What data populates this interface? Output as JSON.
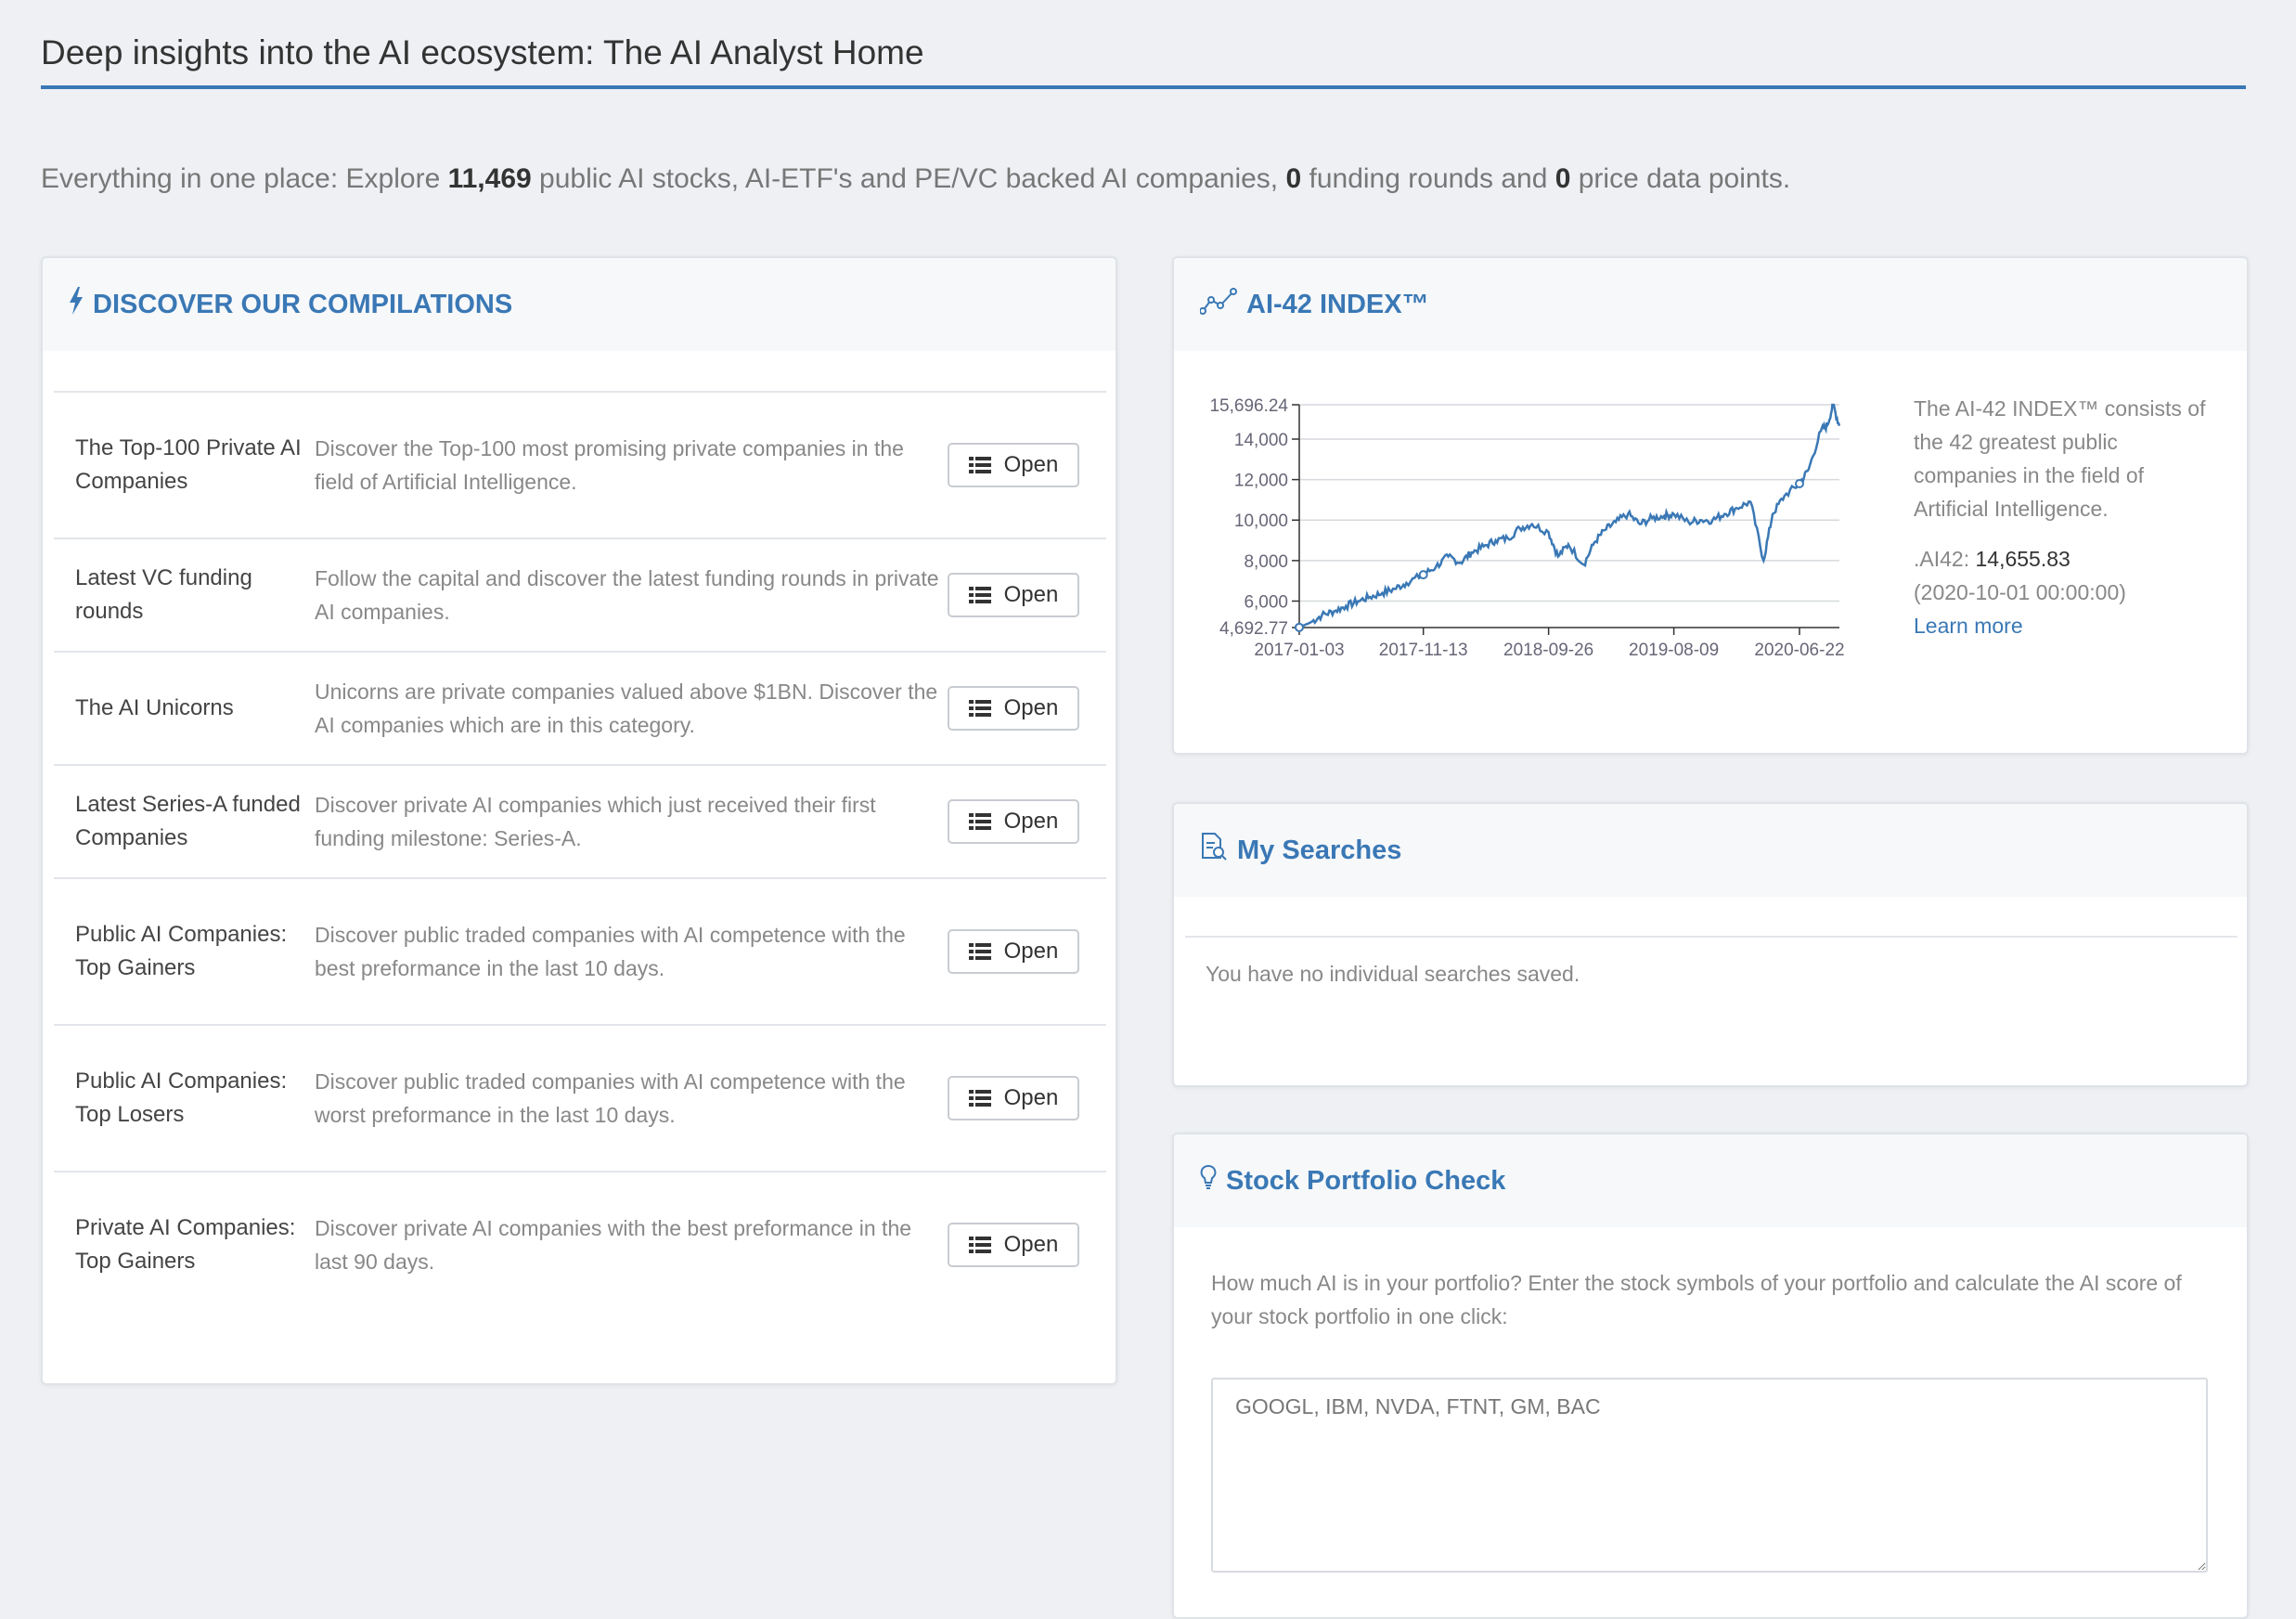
{
  "page": {
    "title": "Deep insights into the AI ecosystem: The AI Analyst Home",
    "intro": {
      "prefix": "Everything in one place: Explore ",
      "stocks_count": "11,469",
      "middle": " public AI stocks, AI-ETF's and PE/VC backed AI companies, ",
      "funding_count": "0",
      "middle2": " funding rounds and ",
      "price_count": "0",
      "suffix": " price data points."
    }
  },
  "compilations": {
    "title": "DISCOVER OUR COMPILATIONS",
    "open_label": "Open",
    "rows": [
      {
        "name": "The Top-100 Private AI Companies",
        "desc": "Discover the Top-100 most promising private companies in the field of Artificial Intelligence."
      },
      {
        "name": "Latest VC funding rounds",
        "desc": "Follow the capital and discover the latest funding rounds in private AI companies."
      },
      {
        "name": "The AI Unicorns",
        "desc": "Unicorns are private companies valued above $1BN. Discover the AI companies which are in this category."
      },
      {
        "name": "Latest Series-A funded Companies",
        "desc": "Discover private AI companies which just received their first funding milestone: Series-A."
      },
      {
        "name": "Public AI Companies: Top Gainers",
        "desc": "Discover public traded companies with AI competence with the best preformance in the last 10 days."
      },
      {
        "name": "Public AI Companies: Top Losers",
        "desc": "Discover public traded companies with AI competence with the worst preformance in the last 10 days."
      },
      {
        "name": "Private AI Companies: Top Gainers",
        "desc": "Discover private AI companies with the best preformance in the last 90 days."
      }
    ]
  },
  "index": {
    "title": "AI-42 INDEX™",
    "description": "The AI-42 INDEX™ consists of the 42 greatest public companies in the field of Artificial Intelligence.",
    "symbol_label": ".AI42: ",
    "value": "14,655.83",
    "timestamp": "(2020-10-01 00:00:00)",
    "learn_more": "Learn more"
  },
  "chart_data": {
    "type": "line",
    "title": "",
    "xlabel": "",
    "ylabel": "",
    "ylim": [
      4692.77,
      15696.24
    ],
    "y_ticks": [
      "15,696.24",
      "14,000",
      "12,000",
      "10,000",
      "8,000",
      "6,000",
      "4,692.77"
    ],
    "y_tick_values": [
      15696.24,
      14000,
      12000,
      10000,
      8000,
      6000,
      4692.77
    ],
    "x_ticks": [
      "2017-01-03",
      "2017-11-13",
      "2018-09-26",
      "2019-08-09",
      "2020-06-22"
    ],
    "grid": true,
    "color": "#3a78b5",
    "series": [
      {
        "x": [
          "2017-01-03",
          "2017-02-01",
          "2017-03-01",
          "2017-04-01",
          "2017-05-01",
          "2017-06-01",
          "2017-07-01",
          "2017-08-01",
          "2017-09-01",
          "2017-10-01",
          "2017-11-13",
          "2017-12-15",
          "2018-01-15",
          "2018-02-15",
          "2018-03-15",
          "2018-04-15",
          "2018-05-15",
          "2018-06-15",
          "2018-07-15",
          "2018-08-15",
          "2018-09-26",
          "2018-10-20",
          "2018-11-15",
          "2018-12-24",
          "2019-01-20",
          "2019-02-15",
          "2019-03-15",
          "2019-04-15",
          "2019-05-15",
          "2019-06-15",
          "2019-07-15",
          "2019-08-09",
          "2019-09-15",
          "2019-10-15",
          "2019-11-15",
          "2019-12-15",
          "2020-01-15",
          "2020-02-19",
          "2020-03-23",
          "2020-04-15",
          "2020-05-15",
          "2020-06-22",
          "2020-07-15",
          "2020-08-15",
          "2020-09-01",
          "2020-09-15",
          "2020-10-01"
        ],
        "values": [
          4700,
          4950,
          5300,
          5500,
          5750,
          6000,
          6200,
          6400,
          6600,
          6900,
          7300,
          7700,
          8200,
          7900,
          8400,
          8700,
          9000,
          9100,
          9600,
          9800,
          9400,
          8200,
          8800,
          7800,
          8900,
          9500,
          9900,
          10300,
          9800,
          10100,
          10200,
          10300,
          9900,
          10000,
          10000,
          10300,
          10600,
          10900,
          8000,
          10300,
          11200,
          11800,
          12500,
          14400,
          14700,
          15696.24,
          14655.83
        ]
      }
    ]
  },
  "searches": {
    "title": "My Searches",
    "empty_message": "You have no individual searches saved."
  },
  "portfolio": {
    "title": "Stock Portfolio Check",
    "description": "How much AI is in your portfolio? Enter the stock symbols of your portfolio and calculate the AI score of your stock portfolio in one click:",
    "input_value": "GOOGL, IBM, NVDA, FTNT, GM, BAC"
  }
}
